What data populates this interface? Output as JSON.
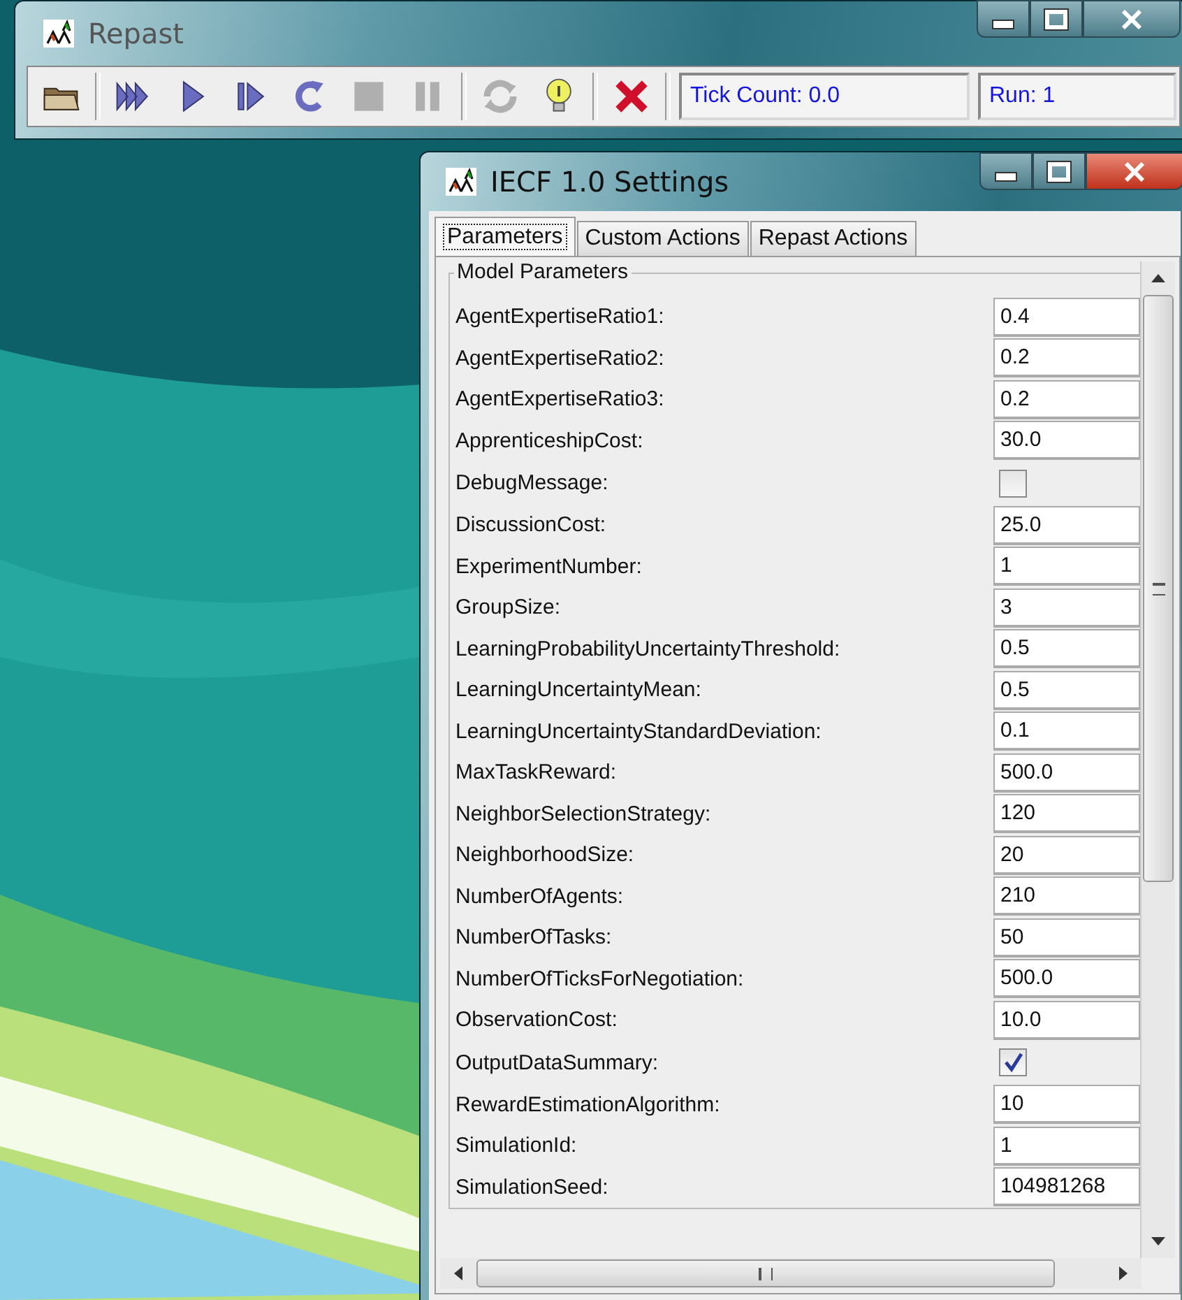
{
  "repast_window": {
    "title": "Repast",
    "toolbar": [
      {
        "kind": "open",
        "disabled": false
      },
      {
        "kind": "sep"
      },
      {
        "kind": "run",
        "disabled": false
      },
      {
        "kind": "start",
        "disabled": false
      },
      {
        "kind": "step",
        "disabled": false
      },
      {
        "kind": "reset",
        "disabled": false
      },
      {
        "kind": "stop",
        "disabled": true
      },
      {
        "kind": "pause",
        "disabled": true
      },
      {
        "kind": "sep"
      },
      {
        "kind": "refresh",
        "disabled": true
      },
      {
        "kind": "info",
        "disabled": false
      },
      {
        "kind": "sep"
      },
      {
        "kind": "quit",
        "disabled": false
      }
    ],
    "tick_count": "Tick Count: 0.0",
    "run": "Run: 1"
  },
  "settings_window": {
    "title": "IECF 1.0 Settings",
    "tabs": [
      {
        "label": "Parameters",
        "selected": true
      },
      {
        "label": "Custom Actions",
        "selected": false
      },
      {
        "label": "Repast Actions",
        "selected": false
      }
    ],
    "group_title": "Model Parameters",
    "parameters": [
      {
        "label": "AgentExpertiseRatio1:",
        "kind": "text",
        "value": "0.4"
      },
      {
        "label": "AgentExpertiseRatio2:",
        "kind": "text",
        "value": "0.2"
      },
      {
        "label": "AgentExpertiseRatio3:",
        "kind": "text",
        "value": "0.2"
      },
      {
        "label": "ApprenticeshipCost:",
        "kind": "text",
        "value": "30.0"
      },
      {
        "label": "DebugMessage:",
        "kind": "checkbox",
        "checked": false
      },
      {
        "label": "DiscussionCost:",
        "kind": "text",
        "value": "25.0"
      },
      {
        "label": "ExperimentNumber:",
        "kind": "text",
        "value": "1"
      },
      {
        "label": "GroupSize:",
        "kind": "text",
        "value": "3"
      },
      {
        "label": "LearningProbabilityUncertaintyThreshold:",
        "kind": "text",
        "value": "0.5"
      },
      {
        "label": "LearningUncertaintyMean:",
        "kind": "text",
        "value": "0.5"
      },
      {
        "label": "LearningUncertaintyStandardDeviation:",
        "kind": "text",
        "value": "0.1"
      },
      {
        "label": "MaxTaskReward:",
        "kind": "text",
        "value": "500.0"
      },
      {
        "label": "NeighborSelectionStrategy:",
        "kind": "text",
        "value": "120"
      },
      {
        "label": "NeighborhoodSize:",
        "kind": "text",
        "value": "20"
      },
      {
        "label": "NumberOfAgents:",
        "kind": "text",
        "value": "210"
      },
      {
        "label": "NumberOfTasks:",
        "kind": "text",
        "value": "50"
      },
      {
        "label": "NumberOfTicksForNegotiation:",
        "kind": "text",
        "value": "500.0"
      },
      {
        "label": "ObservationCost:",
        "kind": "text",
        "value": "10.0"
      },
      {
        "label": "OutputDataSummary:",
        "kind": "checkbox",
        "checked": true
      },
      {
        "label": "RewardEstimationAlgorithm:",
        "kind": "text",
        "value": "10"
      },
      {
        "label": "SimulationId:",
        "kind": "text",
        "value": "1"
      },
      {
        "label": "SimulationSeed:",
        "kind": "text",
        "value": "104981268"
      }
    ]
  }
}
